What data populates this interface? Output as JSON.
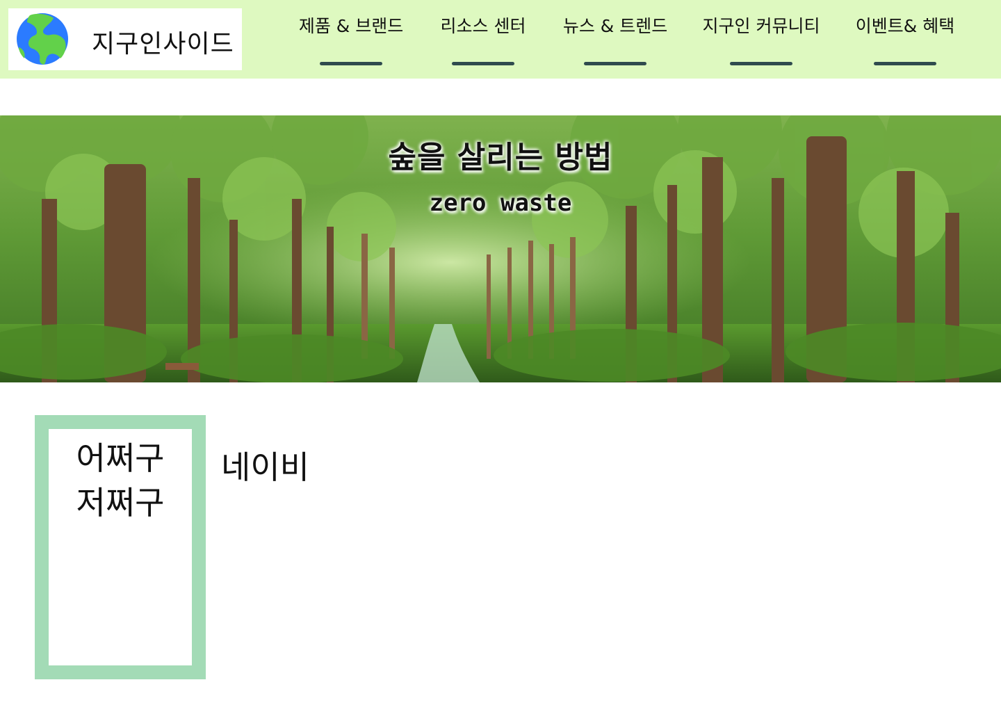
{
  "header": {
    "site_title": "지구인사이드",
    "logo_icon": "earth-globe-icon",
    "background_color": "#def9c0",
    "nav": [
      {
        "label": "제품 & 브랜드"
      },
      {
        "label": "리소스 센터"
      },
      {
        "label": "뉴스 & 트렌드"
      },
      {
        "label": "지구인 커뮤니티"
      },
      {
        "label": "이벤트& 혜택"
      }
    ],
    "underline_color": "#2f4b4e"
  },
  "hero": {
    "title": "숲을 살리는 방법",
    "subtitle": "zero waste",
    "image": "forest-path-banner"
  },
  "sidebar": {
    "lines": [
      "어쩌구",
      "저쩌구"
    ],
    "frame_color": "#a3dbb6"
  },
  "main": {
    "heading": "네이비"
  }
}
